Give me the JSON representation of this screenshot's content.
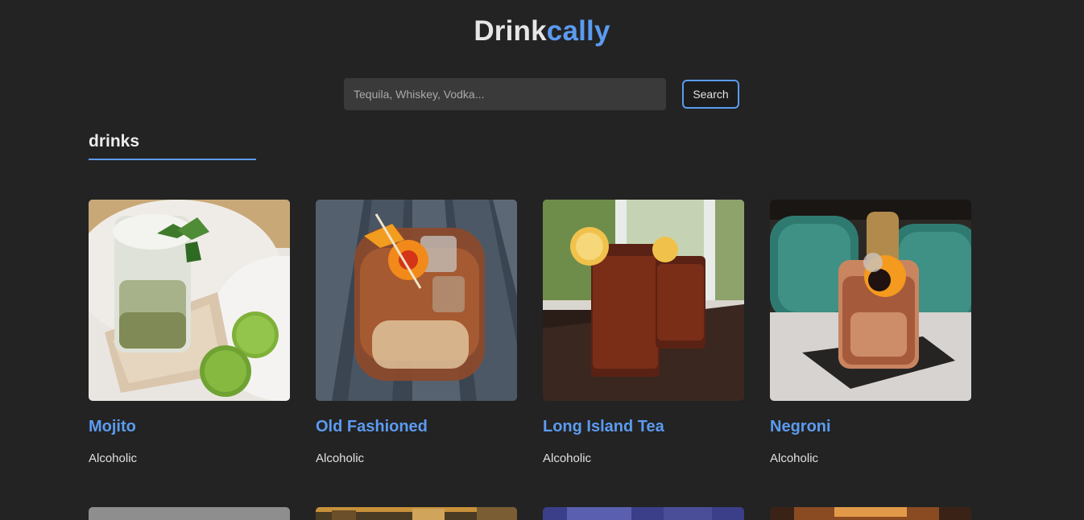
{
  "brand": {
    "part_a": "Drink",
    "part_b": "cally",
    "accent_color": "#5b9bf0"
  },
  "search": {
    "placeholder": "Tequila, Whiskey, Vodka...",
    "value": "",
    "button_label": "Search"
  },
  "section": {
    "title": "drinks"
  },
  "drinks": [
    {
      "name": "Mojito",
      "category": "Alcoholic",
      "image_icon": "mojito-photo"
    },
    {
      "name": "Old Fashioned",
      "category": "Alcoholic",
      "image_icon": "old-fashioned-photo"
    },
    {
      "name": "Long Island Tea",
      "category": "Alcoholic",
      "image_icon": "long-island-tea-photo"
    },
    {
      "name": "Negroni",
      "category": "Alcoholic",
      "image_icon": "negroni-photo"
    }
  ],
  "colors": {
    "background": "#232323",
    "input_background": "#3a3a3a",
    "text_light": "#e0e0e0"
  }
}
